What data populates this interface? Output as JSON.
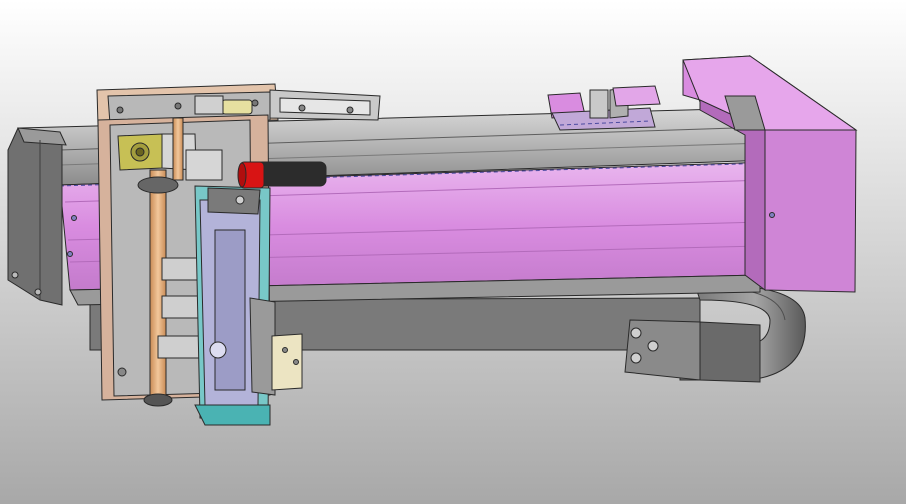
{
  "viewport": {
    "background_top": "#ffffff",
    "background_bottom": "#a8a8a8"
  },
  "colors": {
    "magenta_body": "#d98ce0",
    "magenta_light": "#eab2ee",
    "magenta_dark": "#b36bbb",
    "steel": "#9a9a9a",
    "steel_light": "#c9c9c9",
    "steel_dark": "#5e5e5e",
    "copper": "#e7b27d",
    "brass": "#c7c055",
    "red_knob": "#d81414",
    "cyan_plate": "#78c8c8",
    "lavender_plate": "#b3b3d9",
    "cream_bracket": "#ece4c2",
    "edge": "#2a2a2a"
  },
  "model": {
    "parts": [
      {
        "icon": "motor-block-icon"
      },
      {
        "icon": "linear-rail-icon"
      },
      {
        "icon": "carriage-plate-icon"
      },
      {
        "icon": "copper-shaft-icon"
      },
      {
        "icon": "red-knob-icon"
      },
      {
        "icon": "gripper-plate-icon"
      },
      {
        "icon": "end-housing-icon"
      },
      {
        "icon": "cable-chain-icon"
      },
      {
        "icon": "top-slider-icon"
      },
      {
        "icon": "mounting-bracket-icon"
      }
    ]
  }
}
